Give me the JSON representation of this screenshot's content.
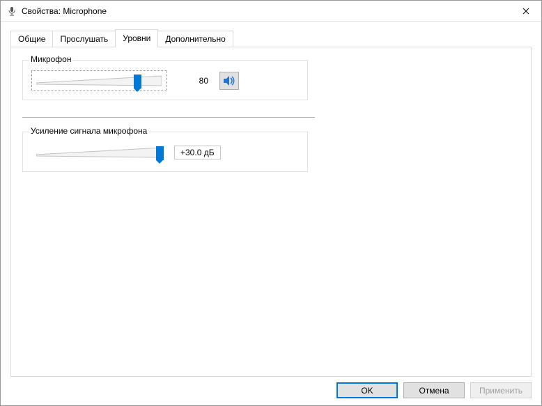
{
  "window": {
    "title": "Свойства: Microphone"
  },
  "tabs": {
    "general": "Общие",
    "listen": "Прослушать",
    "levels": "Уровни",
    "advanced": "Дополнительно",
    "active": "levels"
  },
  "groups": {
    "microphone": {
      "label": "Микрофон",
      "value": "80",
      "percent": 80
    },
    "boost": {
      "label": "Усиление сигнала микрофона",
      "value": "+30.0 дБ",
      "percent": 100
    }
  },
  "buttons": {
    "ok": "OK",
    "cancel": "Отмена",
    "apply": "Применить"
  }
}
